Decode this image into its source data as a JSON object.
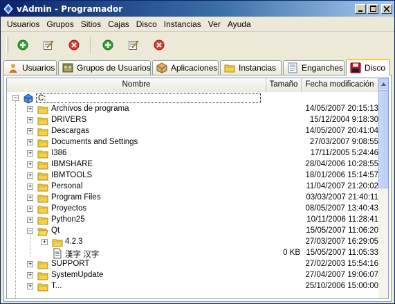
{
  "window": {
    "title": "vAdmin - Programador"
  },
  "menu": [
    "Usuarios",
    "Grupos",
    "Sitios",
    "Cajas",
    "Disco",
    "Instancias",
    "Ver",
    "Ayuda"
  ],
  "toolbar": {
    "buttons": [
      {
        "icon": "add-icon"
      },
      {
        "icon": "edit-icon"
      },
      {
        "icon": "delete-icon"
      },
      {
        "icon": "add-icon"
      },
      {
        "icon": "edit-icon"
      },
      {
        "icon": "delete-icon"
      }
    ]
  },
  "tabs": [
    {
      "label": "Usuarios",
      "icon": "users-icon"
    },
    {
      "label": "Grupos de Usuarios",
      "icon": "user-groups-icon"
    },
    {
      "label": "Aplicaciones",
      "icon": "applications-icon"
    },
    {
      "label": "Instancias",
      "icon": "instances-folder-icon"
    },
    {
      "label": "Enganches",
      "icon": "hooks-icon"
    },
    {
      "label": "Disco",
      "icon": "disk-icon",
      "active": true
    }
  ],
  "columns": {
    "name": "Nombre",
    "size": "Tamaño",
    "date": "Fecha modificación"
  },
  "tree": [
    {
      "name": "C:",
      "size": "",
      "date": "",
      "level": 0,
      "type": "drive",
      "expanded": true
    },
    {
      "name": "Archivos de programa",
      "size": "",
      "date": "14/05/2007 20:15:13",
      "level": 1,
      "type": "folder"
    },
    {
      "name": "DRIVERS",
      "size": "",
      "date": "15/12/2004 9:18:30",
      "level": 1,
      "type": "folder"
    },
    {
      "name": "Descargas",
      "size": "",
      "date": "14/05/2007 20:41:04",
      "level": 1,
      "type": "folder"
    },
    {
      "name": "Documents and Settings",
      "size": "",
      "date": "27/03/2007 9:08:55",
      "level": 1,
      "type": "folder"
    },
    {
      "name": "I386",
      "size": "",
      "date": "17/11/2005 5:24:46",
      "level": 1,
      "type": "folder"
    },
    {
      "name": "IBMSHARE",
      "size": "",
      "date": "28/04/2006 10:28:55",
      "level": 1,
      "type": "folder"
    },
    {
      "name": "IBMTOOLS",
      "size": "",
      "date": "18/01/2006 15:14:57",
      "level": 1,
      "type": "folder"
    },
    {
      "name": "Personal",
      "size": "",
      "date": "11/04/2007 21:20:02",
      "level": 1,
      "type": "folder"
    },
    {
      "name": "Program Files",
      "size": "",
      "date": "03/03/2007 21:40:11",
      "level": 1,
      "type": "folder"
    },
    {
      "name": "Proyectos",
      "size": "",
      "date": "08/05/2007 13:40:43",
      "level": 1,
      "type": "folder"
    },
    {
      "name": "Python25",
      "size": "",
      "date": "10/11/2006 11:28:41",
      "level": 1,
      "type": "folder"
    },
    {
      "name": "Qt",
      "size": "",
      "date": "15/05/2007 11:06:20",
      "level": 1,
      "type": "folder",
      "expanded": true
    },
    {
      "name": "4.2.3",
      "size": "",
      "date": "27/03/2007 16:29:05",
      "level": 2,
      "type": "folder"
    },
    {
      "name": "漢字 汉字",
      "size": "0 KB",
      "date": "15/05/2007 11:05:33",
      "level": 2,
      "type": "file"
    },
    {
      "name": "SUPPORT",
      "size": "",
      "date": "27/02/2003 15:54:16",
      "level": 1,
      "type": "folder"
    },
    {
      "name": "SystemUpdate",
      "size": "",
      "date": "27/04/2007 19:06:07",
      "level": 1,
      "type": "folder"
    },
    {
      "name": "T...",
      "size": "",
      "date": "25/10/2006 15:00:00",
      "level": 1,
      "type": "folder"
    }
  ],
  "colors": {
    "title_start": "#0a246a",
    "title_end": "#a6caf0",
    "active_tab_accent": "#ffc83c",
    "folder": "#f5d04a"
  }
}
